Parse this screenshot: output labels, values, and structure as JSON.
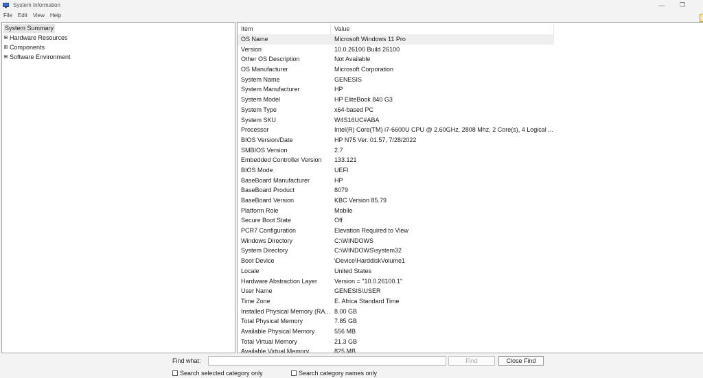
{
  "window": {
    "title": "System Information",
    "min_glyph": "—",
    "max_glyph": "❐"
  },
  "menu": [
    "File",
    "Edit",
    "View",
    "Help"
  ],
  "tree": {
    "root": "System Summary",
    "children": [
      "Hardware Resources",
      "Components",
      "Software Environment"
    ]
  },
  "table": {
    "headers": {
      "item": "Item",
      "value": "Value"
    },
    "rows": [
      {
        "item": "OS Name",
        "value": "Microsoft Windows 11 Pro"
      },
      {
        "item": "Version",
        "value": "10.0.26100 Build 26100"
      },
      {
        "item": "Other OS Description",
        "value": "Not Available"
      },
      {
        "item": "OS Manufacturer",
        "value": "Microsoft Corporation"
      },
      {
        "item": "System Name",
        "value": "GENESIS"
      },
      {
        "item": "System Manufacturer",
        "value": "HP"
      },
      {
        "item": "System Model",
        "value": "HP EliteBook 840 G3"
      },
      {
        "item": "System Type",
        "value": "x64-based PC"
      },
      {
        "item": "System SKU",
        "value": "W4S16UC#ABA"
      },
      {
        "item": "Processor",
        "value": "Intel(R) Core(TM) i7-6600U CPU @ 2.60GHz, 2808 Mhz, 2 Core(s), 4 Logical ..."
      },
      {
        "item": "BIOS Version/Date",
        "value": "HP N75 Ver. 01.57, 7/28/2022"
      },
      {
        "item": "SMBIOS Version",
        "value": "2.7"
      },
      {
        "item": "Embedded Controller Version",
        "value": "133.121"
      },
      {
        "item": "BIOS Mode",
        "value": "UEFI"
      },
      {
        "item": "BaseBoard Manufacturer",
        "value": "HP"
      },
      {
        "item": "BaseBoard Product",
        "value": "8079"
      },
      {
        "item": "BaseBoard Version",
        "value": "KBC Version 85.79"
      },
      {
        "item": "Platform Role",
        "value": "Mobile"
      },
      {
        "item": "Secure Boot State",
        "value": "Off"
      },
      {
        "item": "PCR7 Configuration",
        "value": "Elevation Required to View"
      },
      {
        "item": "Windows Directory",
        "value": "C:\\WINDOWS"
      },
      {
        "item": "System Directory",
        "value": "C:\\WINDOWS\\system32"
      },
      {
        "item": "Boot Device",
        "value": "\\Device\\HarddiskVolume1"
      },
      {
        "item": "Locale",
        "value": "United States"
      },
      {
        "item": "Hardware Abstraction Layer",
        "value": "Version = \"10.0.26100.1\""
      },
      {
        "item": "User Name",
        "value": "GENESIS\\USER"
      },
      {
        "item": "Time Zone",
        "value": "E. Africa Standard Time"
      },
      {
        "item": "Installed Physical Memory (RA...",
        "value": "8.00 GB"
      },
      {
        "item": "Total Physical Memory",
        "value": "7.85 GB"
      },
      {
        "item": "Available Physical Memory",
        "value": "556 MB"
      },
      {
        "item": "Total Virtual Memory",
        "value": "21.3 GB"
      },
      {
        "item": "Available Virtual Memory",
        "value": "825 MB"
      }
    ]
  },
  "find": {
    "label": "Find what:",
    "value": "",
    "find_button": "Find",
    "close_button": "Close Find",
    "checkbox_selected": "Search selected category only",
    "checkbox_names": "Search category names only"
  }
}
